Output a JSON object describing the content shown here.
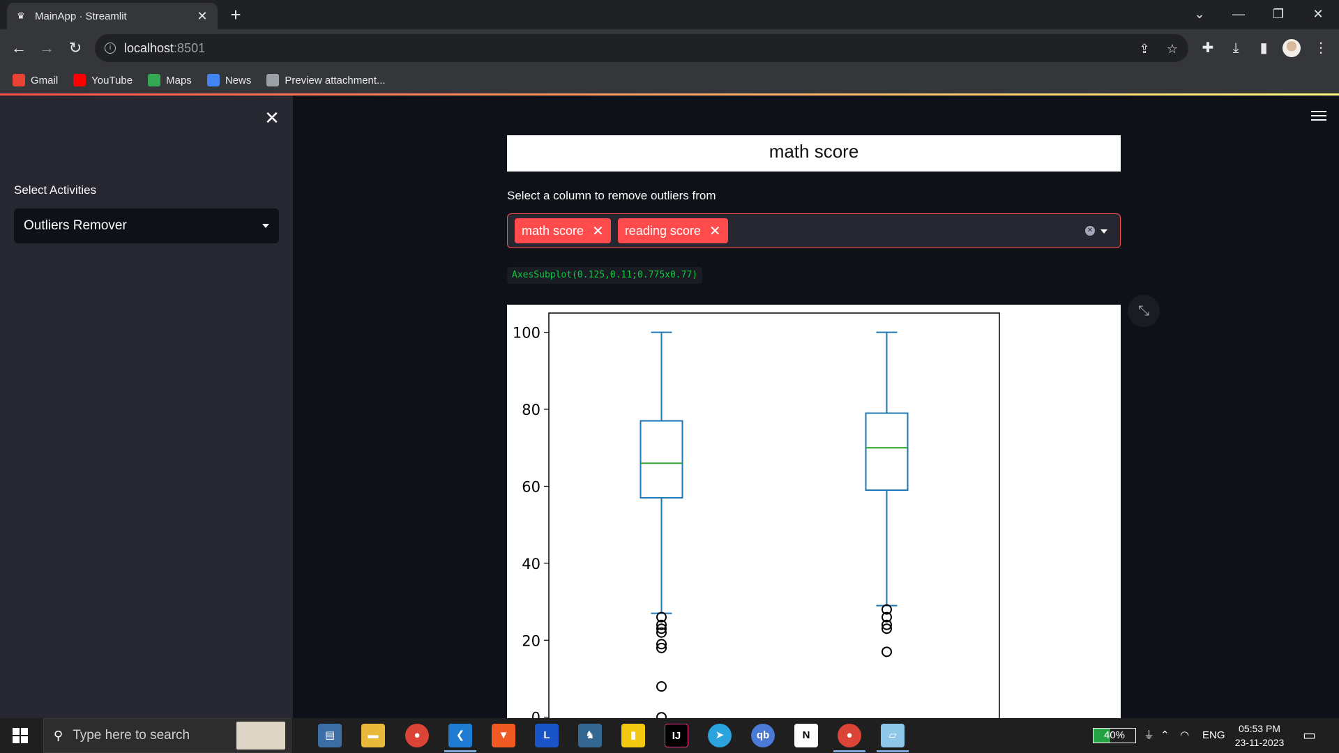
{
  "browser": {
    "tab_title": "MainApp · Streamlit",
    "url_host": "localhost",
    "url_port": ":8501",
    "bookmarks": [
      {
        "label": "Gmail",
        "icon": "gmail-icon",
        "color": "#ea4335"
      },
      {
        "label": "YouTube",
        "icon": "youtube-icon",
        "color": "#ff0000"
      },
      {
        "label": "Maps",
        "icon": "maps-icon",
        "color": "#34a853"
      },
      {
        "label": "News",
        "icon": "news-icon",
        "color": "#4285f4"
      },
      {
        "label": "Preview attachment...",
        "icon": "globe-icon",
        "color": "#9aa0a6"
      }
    ]
  },
  "sidebar": {
    "select_label": "Select Activities",
    "select_value": "Outliers Remover"
  },
  "main": {
    "header": "math score",
    "multiselect_label": "Select a column to remove outliers from",
    "selected_columns": [
      "math score",
      "reading score"
    ],
    "code_output": "AxesSubplot(0.125,0.11;0.775x0.77)"
  },
  "chart_data": {
    "type": "box",
    "title": "",
    "xlabel": "",
    "ylabel": "",
    "ylim": [
      0,
      105
    ],
    "yticks": [
      0,
      20,
      40,
      60,
      80,
      100
    ],
    "box_color": "#1f77b4",
    "median_color": "#2ca02c",
    "series": [
      {
        "whisker_low": 27,
        "q1": 57,
        "median": 66,
        "q3": 77,
        "whisker_high": 100,
        "outliers": [
          0,
          8,
          18,
          19,
          22,
          23,
          24,
          26
        ]
      },
      {
        "whisker_low": 29,
        "q1": 59,
        "median": 70,
        "q3": 79,
        "whisker_high": 100,
        "outliers": [
          17,
          23,
          24,
          26,
          28
        ]
      }
    ]
  },
  "taskbar": {
    "search_placeholder": "Type here to search",
    "battery": "40%",
    "battery_level": 0.4,
    "language": "ENG",
    "time": "05:53 PM",
    "date": "23-11-2023"
  }
}
